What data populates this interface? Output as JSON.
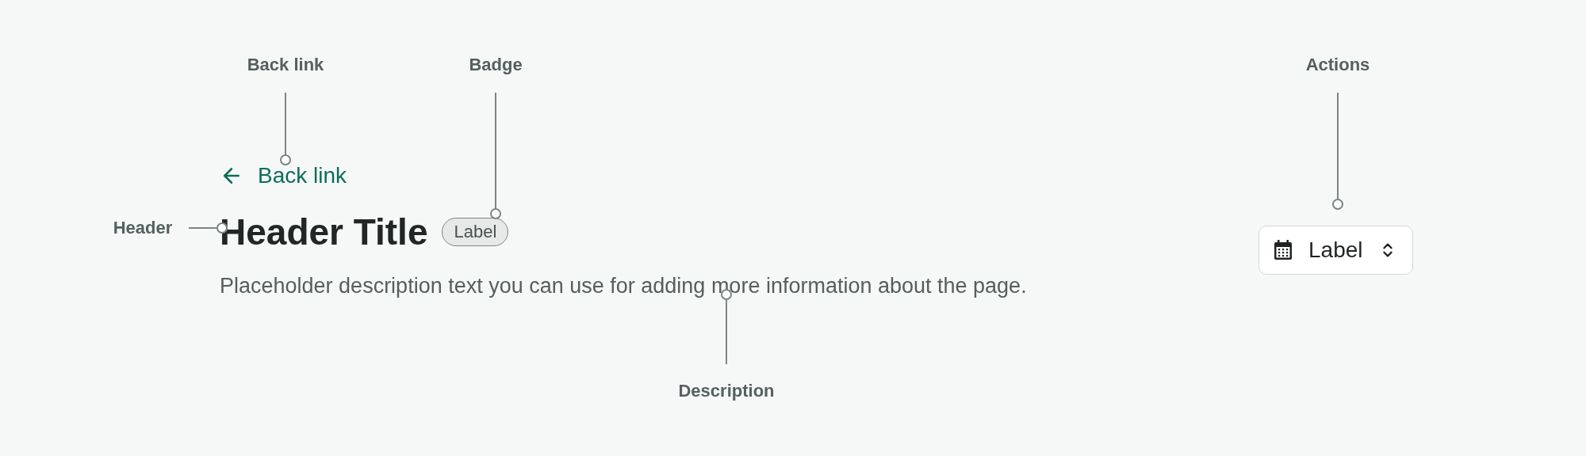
{
  "callouts": [
    {
      "label": "Back link"
    },
    {
      "label": "Badge"
    },
    {
      "label": "Header"
    },
    {
      "label": "Description"
    },
    {
      "label": "Actions"
    }
  ],
  "page_header": {
    "back_link": {
      "label": "Back link"
    },
    "title": "Header Title",
    "badge": {
      "label": "Label"
    },
    "description": "Placeholder description text you can use for adding more information about the page.",
    "action": {
      "label": "Label"
    }
  }
}
